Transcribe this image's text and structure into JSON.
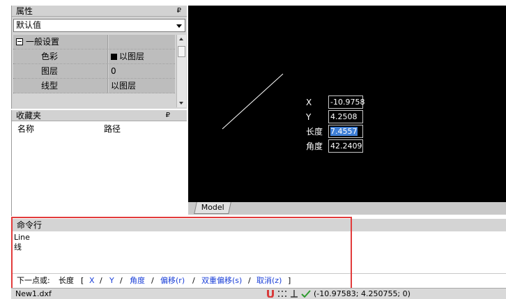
{
  "properties": {
    "title": "属性",
    "pin": "₽",
    "dropdown_value": "默认值",
    "section": "一般设置",
    "rows": [
      {
        "label": "色彩",
        "value": "以图层"
      },
      {
        "label": "图层",
        "value": "0"
      },
      {
        "label": "线型",
        "value": "以图层"
      }
    ]
  },
  "favorites": {
    "title": "收藏夹",
    "pin": "₽",
    "columns": [
      "名称",
      "路径"
    ]
  },
  "canvas": {
    "coords": {
      "x_label": "X",
      "x_value": "-10.9758",
      "y_label": "Y",
      "y_value": "4.2508",
      "length_label": "长度",
      "length_value": "7.4557",
      "angle_label": "角度",
      "angle_value": "42.2409"
    },
    "tab_model": "Model"
  },
  "command": {
    "title": "命令行",
    "history": [
      "Line",
      "线"
    ],
    "prompt": {
      "label": "下一点或:",
      "current": "长度",
      "open": "[",
      "options": [
        "X",
        "Y",
        "角度",
        "偏移(r)",
        "双重偏移(s)",
        "取消(z)"
      ],
      "sep": "/",
      "close": "]"
    }
  },
  "status": {
    "filename": "New1.dxf",
    "coordinates": "(-10.97583; 4.250755; 0)"
  },
  "colors": {
    "canvas_bg": "#000000",
    "highlight": "#e23b3b",
    "option_link": "#1a3fd8",
    "selection": "#3f7fd6"
  }
}
